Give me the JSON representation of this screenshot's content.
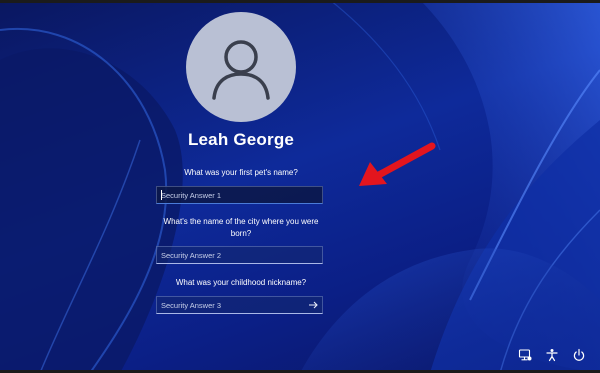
{
  "user": {
    "name": "Leah George"
  },
  "security_questions": [
    {
      "question": "What was your first pet's name?",
      "placeholder": "Security Answer 1"
    },
    {
      "question": "What's the name of the city where you were born?",
      "placeholder": "Security Answer 2"
    },
    {
      "question": "What was your childhood nickname?",
      "placeholder": "Security Answer 3"
    }
  ],
  "icons": {
    "avatar": "person-icon",
    "submit": "arrow-right-icon",
    "network": "network-icon",
    "accessibility": "accessibility-icon",
    "power": "power-icon",
    "annotation": "red-arrow-icon"
  },
  "colors": {
    "accent": "#4a7bd8",
    "annotation": "#e3151e",
    "avatar_bg": "#b9c0d4"
  }
}
